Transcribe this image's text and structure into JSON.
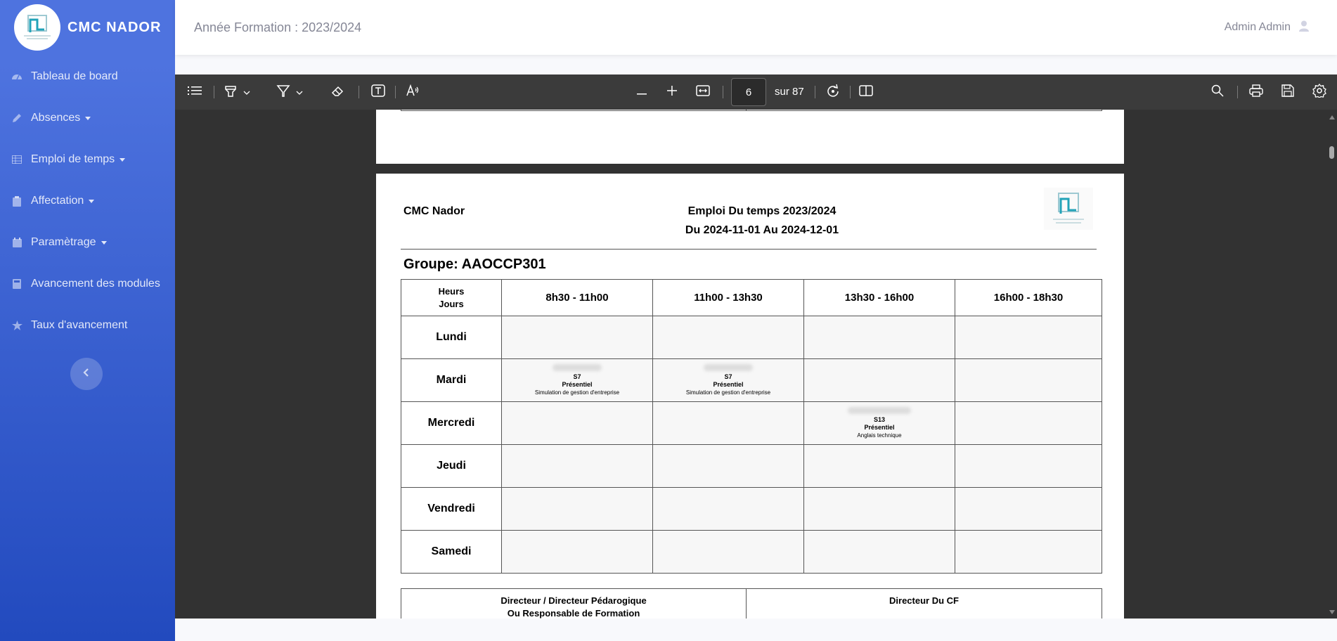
{
  "brand": {
    "name": "CMC NADOR"
  },
  "sidebar": {
    "items": [
      {
        "label": "Tableau de board",
        "icon": "dashboard-icon"
      },
      {
        "label": "Absences",
        "icon": "pencil-icon"
      },
      {
        "label": "Emploi de temps",
        "icon": "table-icon"
      },
      {
        "label": "Affectation",
        "icon": "clipboard-icon"
      },
      {
        "label": "Paramètrage",
        "icon": "calendar-icon"
      },
      {
        "label": "Avancement des modules",
        "icon": "calculator-icon"
      },
      {
        "label": "Taux d'avancement",
        "icon": "star-icon"
      }
    ]
  },
  "topbar": {
    "year": "Année Formation : 2023/2024",
    "user": "Admin Admin"
  },
  "toolbar": {
    "page": "6",
    "total": "sur 87"
  },
  "document": {
    "org": "CMC Nador",
    "title": "Emploi Du temps 2023/2024",
    "period": "Du 2024-11-01 Au 2024-12-01",
    "group": "Groupe: AAOCCP301",
    "corner_line1": "Heurs",
    "corner_line2": "Jours",
    "slots": [
      "8h30 - 11h00",
      "11h00 - 13h30",
      "13h30 - 16h00",
      "16h00 - 18h30"
    ],
    "days": [
      "Lundi",
      "Mardi",
      "Mercredi",
      "Jeudi",
      "Vendredi",
      "Samedi"
    ],
    "sessions": {
      "mardi_1": {
        "room": "S7",
        "mode": "Présentiel",
        "module": "Simulation de gestion d'entreprise"
      },
      "mardi_2": {
        "room": "S7",
        "mode": "Présentiel",
        "module": "Simulation de gestion d'entreprise"
      },
      "mercredi_3": {
        "room": "S13",
        "mode": "Présentiel",
        "module": "Anglais technique"
      }
    },
    "sig_left_1": "Directeur / Directeur Pédarogique",
    "sig_left_2": "Ou Responsable de Formation",
    "sig_right": "Directeur Du CF"
  }
}
